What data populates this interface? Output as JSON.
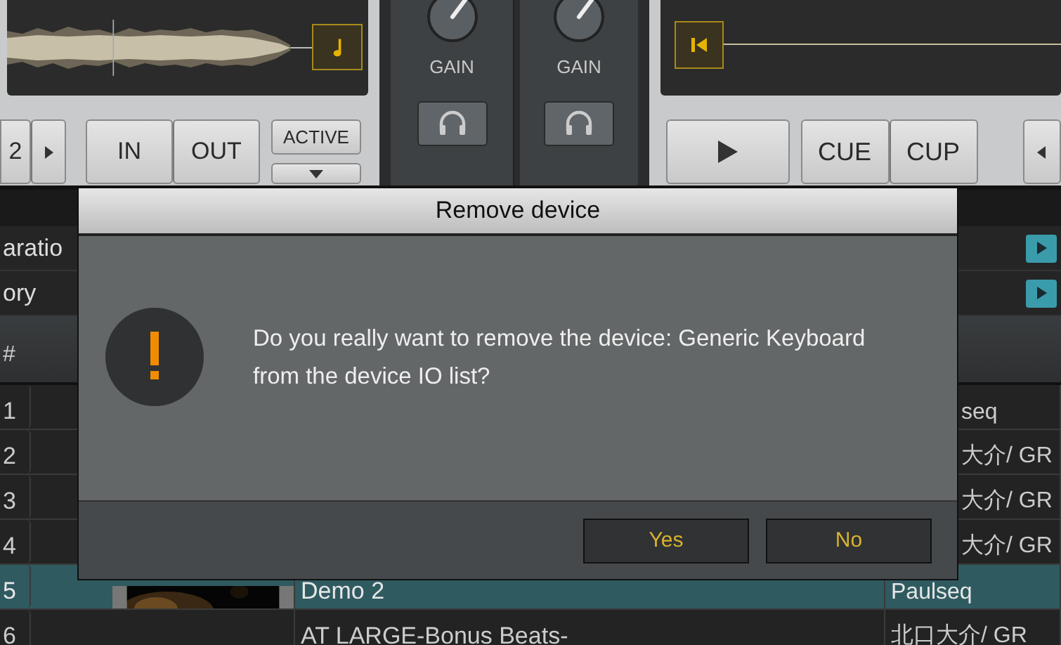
{
  "left_deck": {
    "deck_button": "2",
    "loop_buttons": [
      "IN",
      "OUT"
    ],
    "active_button": "ACTIVE"
  },
  "mixer": {
    "channels": [
      {
        "label": "GAIN"
      },
      {
        "label": "GAIN"
      }
    ]
  },
  "right_deck": {
    "cue_buttons": [
      "CUE",
      "CUP"
    ]
  },
  "browser": {
    "favorites": [
      {
        "label": "aratio"
      },
      {
        "label": "ory"
      }
    ],
    "header": "#",
    "rows": [
      {
        "number": "1",
        "artist": "seq",
        "selected": false,
        "artwork": false
      },
      {
        "number": "2",
        "artist": "大介/ GR",
        "selected": false,
        "artwork": false
      },
      {
        "number": "3",
        "artist": "大介/ GR",
        "selected": false,
        "artwork": false
      },
      {
        "number": "4",
        "artist": "大介/ GR",
        "selected": false,
        "artwork": false
      },
      {
        "number": "5",
        "title": "Demo 2",
        "artist": "Paulseq",
        "selected": true,
        "artwork": true
      },
      {
        "number": "6",
        "title": "AT LARGE-Bonus Beats-",
        "artist": "北口大介/ GR",
        "selected": false,
        "artwork": false
      }
    ]
  },
  "dialog": {
    "title": "Remove device",
    "message": "Do you really want to remove the device: Generic Keyboard from the device IO list?",
    "buttons": [
      "Yes",
      "No"
    ]
  }
}
